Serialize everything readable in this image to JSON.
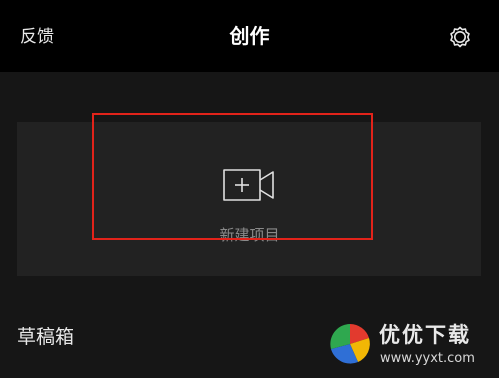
{
  "header": {
    "feedback_label": "反馈",
    "title": "创作",
    "settings_icon": "gear-icon"
  },
  "create": {
    "new_project_label": "新建项目",
    "icon": "add-video-camera-icon"
  },
  "drafts": {
    "title": "草稿箱"
  },
  "watermark": {
    "name": "优优下载",
    "url": "www.yyxt.com"
  },
  "colors": {
    "header_bg": "#000000",
    "page_bg": "#161616",
    "card_bg": "#222222",
    "highlight": "#e2231a"
  }
}
